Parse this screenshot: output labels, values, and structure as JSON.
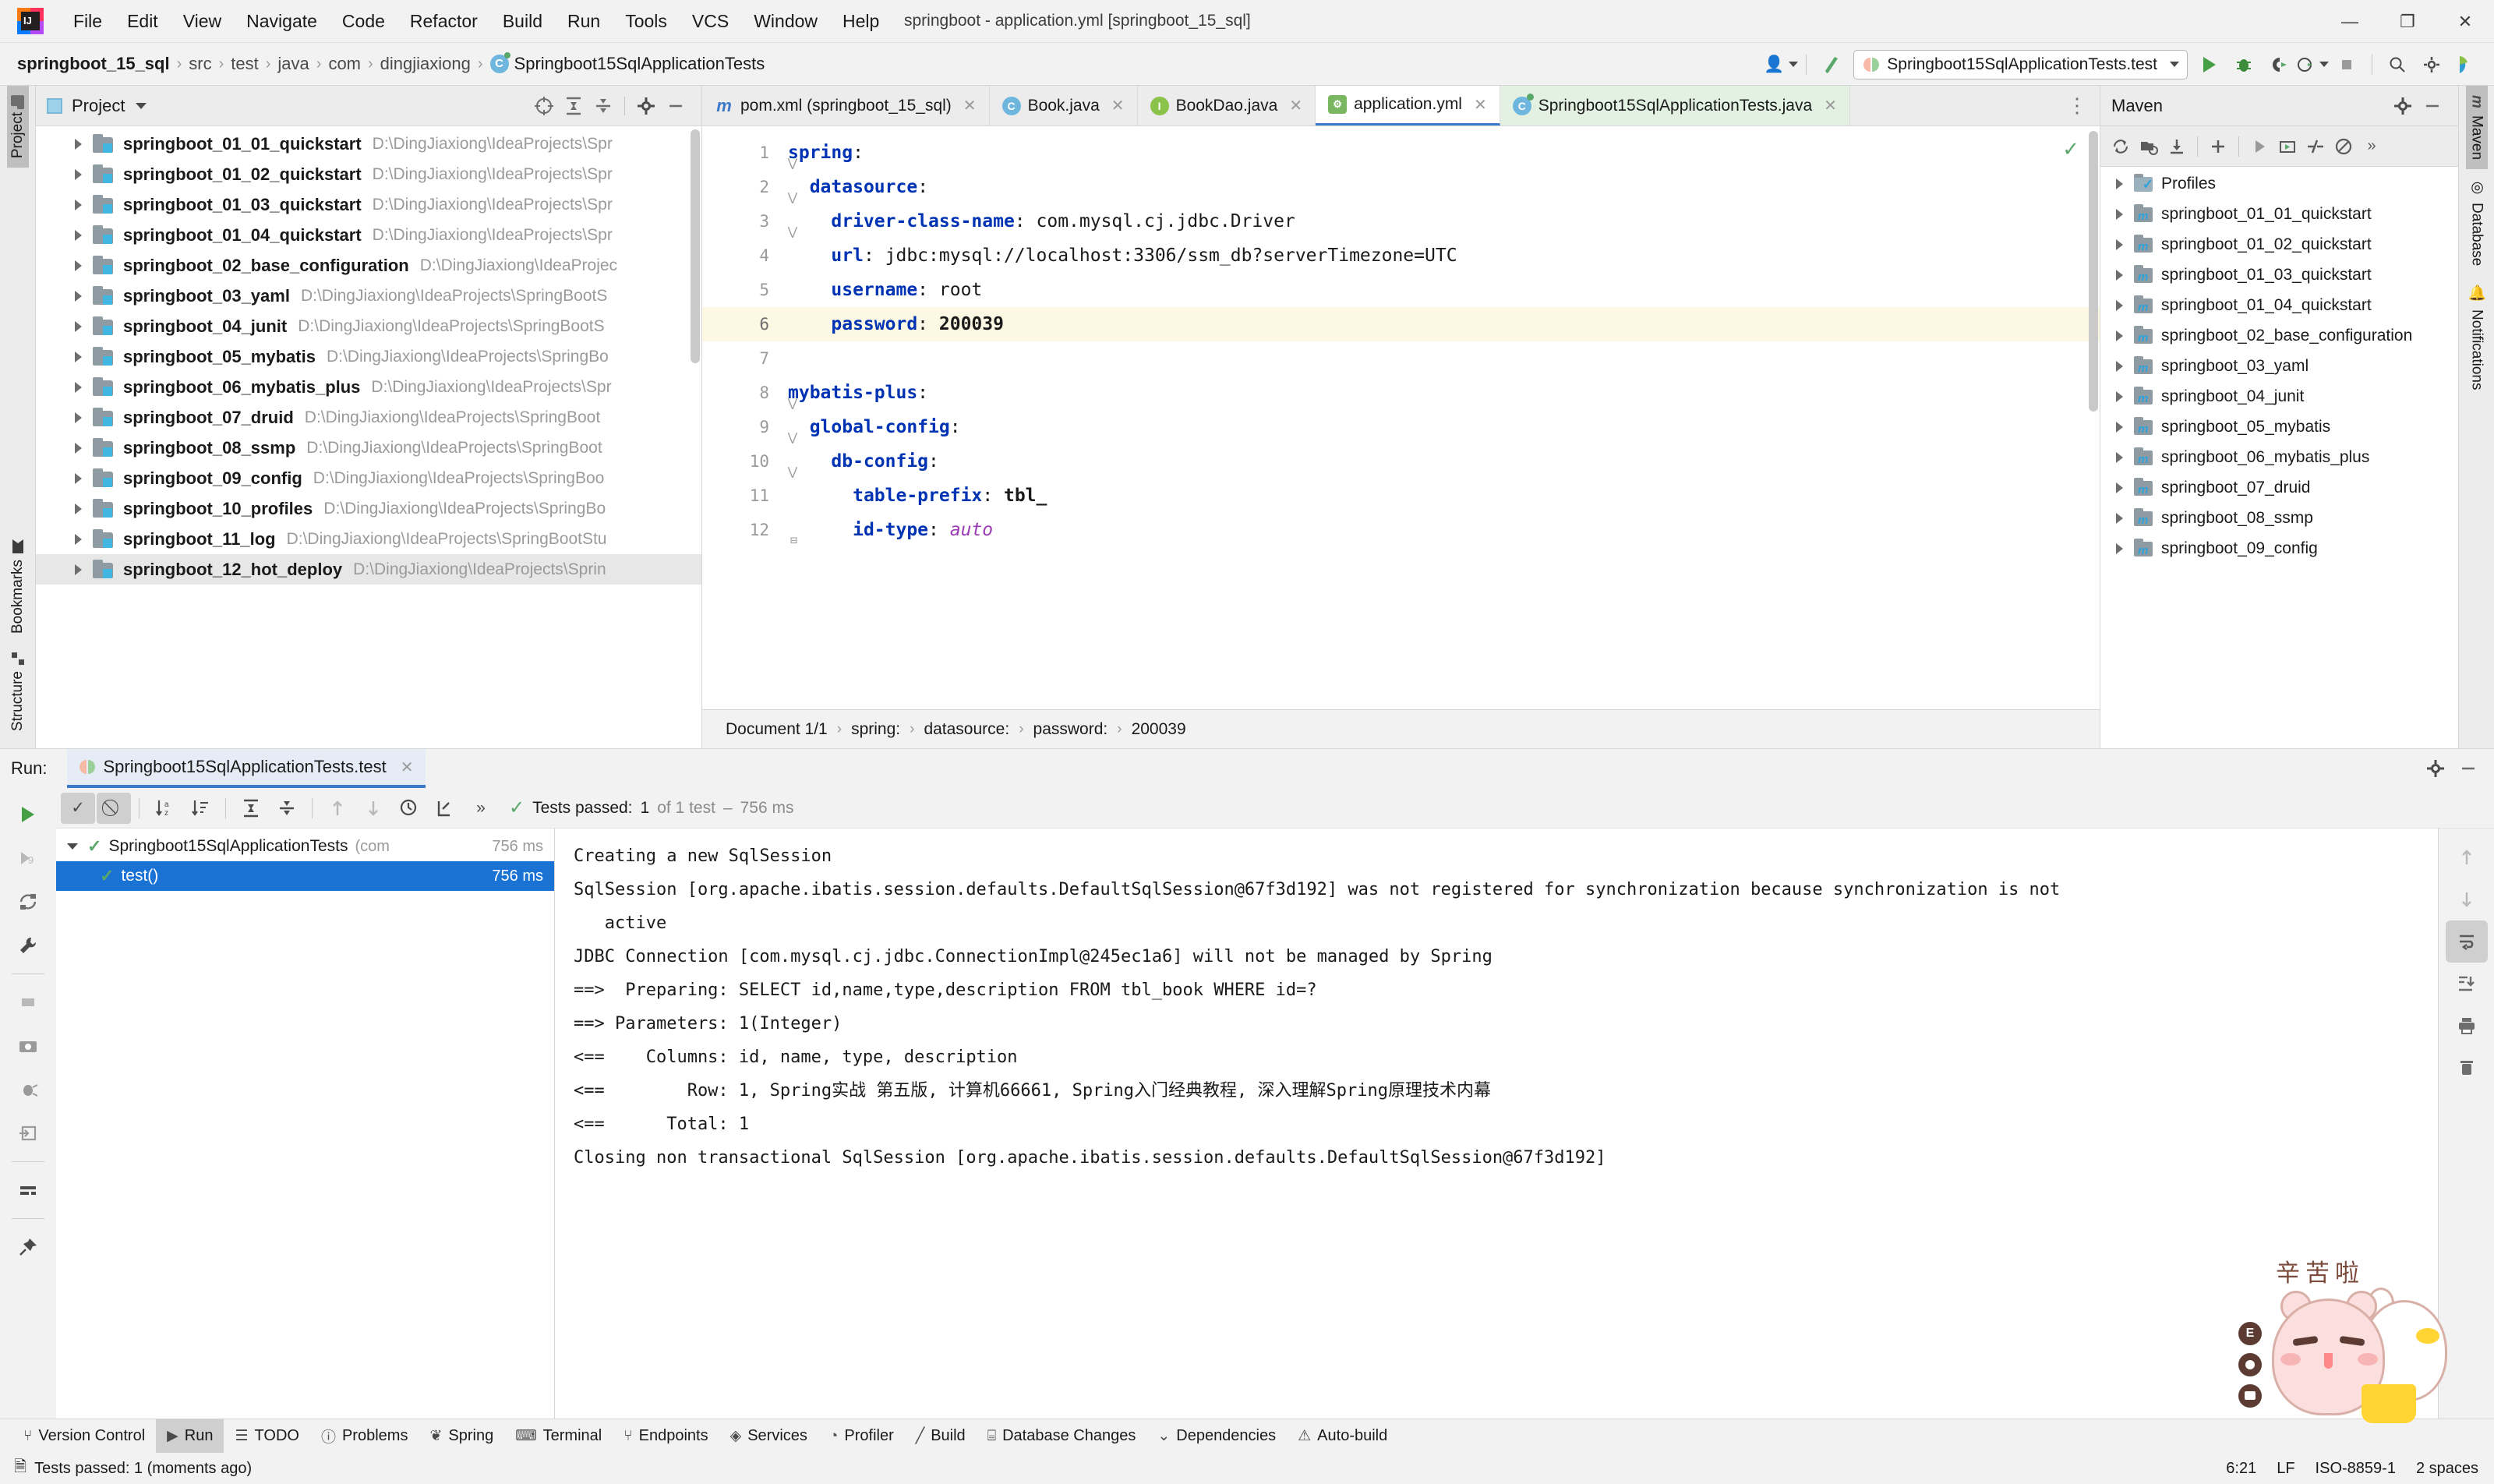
{
  "window": {
    "title": "springboot - application.yml [springboot_15_sql]",
    "minimize": "—",
    "maximize": "❐",
    "close": "✕",
    "logo_text": "IJ"
  },
  "menubar": {
    "items": [
      "File",
      "Edit",
      "View",
      "Navigate",
      "Code",
      "Refactor",
      "Build",
      "Run",
      "Tools",
      "VCS",
      "Window",
      "Help"
    ]
  },
  "navbar": {
    "crumbs": [
      "springboot_15_sql",
      "src",
      "test",
      "java",
      "com",
      "dingjiaxiong",
      "Springboot15SqlApplicationTests"
    ],
    "class_icon_letter": "C",
    "run_config": "Springboot15SqlApplicationTests.test",
    "icons": [
      "user-dropdown-icon",
      "build-hammer-icon",
      "run-icon",
      "debug-icon",
      "run-with-coverage-icon",
      "profile-icon",
      "stop-icon",
      "search-icon",
      "settings-icon",
      "ide-help-icon"
    ]
  },
  "left_strip": {
    "project_tab": "Project",
    "bookmarks_tab": "Bookmarks",
    "structure_tab": "Structure"
  },
  "project_panel": {
    "title": "Project",
    "toolbar_icons": [
      "select-opened-file-icon",
      "expand-all-icon",
      "collapse-all-icon",
      "gear-icon",
      "hide-icon"
    ],
    "items": [
      {
        "name": "springboot_01_01_quickstart",
        "path": "D:\\DingJiaxiong\\IdeaProjects\\Spr"
      },
      {
        "name": "springboot_01_02_quickstart",
        "path": "D:\\DingJiaxiong\\IdeaProjects\\Spr"
      },
      {
        "name": "springboot_01_03_quickstart",
        "path": "D:\\DingJiaxiong\\IdeaProjects\\Spr"
      },
      {
        "name": "springboot_01_04_quickstart",
        "path": "D:\\DingJiaxiong\\IdeaProjects\\Spr"
      },
      {
        "name": "springboot_02_base_configuration",
        "path": "D:\\DingJiaxiong\\IdeaProjec"
      },
      {
        "name": "springboot_03_yaml",
        "path": "D:\\DingJiaxiong\\IdeaProjects\\SpringBootS"
      },
      {
        "name": "springboot_04_junit",
        "path": "D:\\DingJiaxiong\\IdeaProjects\\SpringBootS"
      },
      {
        "name": "springboot_05_mybatis",
        "path": "D:\\DingJiaxiong\\IdeaProjects\\SpringBo"
      },
      {
        "name": "springboot_06_mybatis_plus",
        "path": "D:\\DingJiaxiong\\IdeaProjects\\Spr"
      },
      {
        "name": "springboot_07_druid",
        "path": "D:\\DingJiaxiong\\IdeaProjects\\SpringBoot"
      },
      {
        "name": "springboot_08_ssmp",
        "path": "D:\\DingJiaxiong\\IdeaProjects\\SpringBoot"
      },
      {
        "name": "springboot_09_config",
        "path": "D:\\DingJiaxiong\\IdeaProjects\\SpringBoo"
      },
      {
        "name": "springboot_10_profiles",
        "path": "D:\\DingJiaxiong\\IdeaProjects\\SpringBo"
      },
      {
        "name": "springboot_11_log",
        "path": "D:\\DingJiaxiong\\IdeaProjects\\SpringBootStu"
      },
      {
        "name": "springboot_12_hot_deploy",
        "path": "D:\\DingJiaxiong\\IdeaProjects\\Sprin"
      }
    ]
  },
  "editor": {
    "tabs": [
      {
        "label": "pom.xml (springboot_15_sql)",
        "icon": "maven-file-icon",
        "active": false,
        "green": false
      },
      {
        "label": "Book.java",
        "icon": "java-class-icon",
        "active": false,
        "green": false
      },
      {
        "label": "BookDao.java",
        "icon": "java-interface-icon",
        "active": false,
        "green": false
      },
      {
        "label": "application.yml",
        "icon": "spring-yaml-icon",
        "active": true,
        "green": false
      },
      {
        "label": "Springboot15SqlApplicationTests.java",
        "icon": "java-test-class-icon",
        "active": false,
        "green": true
      }
    ],
    "tab_close": "✕",
    "overflow": "⋮",
    "inspection_ok": "✓",
    "line_numbers": [
      "1",
      "2",
      "3",
      "4",
      "5",
      "6",
      "7",
      "8",
      "9",
      "10",
      "11",
      "12"
    ],
    "current_line": 6,
    "lines": [
      {
        "n": 1,
        "indent": 0,
        "key": "spring",
        "value": ""
      },
      {
        "n": 2,
        "indent": 1,
        "key": "datasource",
        "value": ""
      },
      {
        "n": 3,
        "indent": 2,
        "key": "driver-class-name",
        "value": "com.mysql.cj.jdbc.Driver"
      },
      {
        "n": 4,
        "indent": 2,
        "key": "url",
        "value": "jdbc:mysql://localhost:3306/ssm_db?serverTimezone=UTC"
      },
      {
        "n": 5,
        "indent": 2,
        "key": "username",
        "value": "root"
      },
      {
        "n": 6,
        "indent": 2,
        "key": "password",
        "value": "200039"
      },
      {
        "n": 7,
        "indent": 0,
        "key": "",
        "value": ""
      },
      {
        "n": 8,
        "indent": 0,
        "key": "mybatis-plus",
        "value": ""
      },
      {
        "n": 9,
        "indent": 1,
        "key": "global-config",
        "value": ""
      },
      {
        "n": 10,
        "indent": 2,
        "key": "db-config",
        "value": ""
      },
      {
        "n": 11,
        "indent": 3,
        "key": "table-prefix",
        "value": "tbl_"
      },
      {
        "n": 12,
        "indent": 3,
        "key": "id-type",
        "value": "auto"
      }
    ],
    "breadcrumb": [
      "Document 1/1",
      "spring:",
      "datasource:",
      "password:",
      "200039"
    ]
  },
  "maven_panel": {
    "title": "Maven",
    "toolbar_icons": [
      "reload-icon",
      "add-module-icon",
      "download-sources-icon",
      "add-icon",
      "run-icon",
      "execute-goal-icon",
      "skip-tests-icon",
      "toggle-offline-icon",
      "more-icon"
    ],
    "items": [
      "Profiles",
      "springboot_01_01_quickstart",
      "springboot_01_02_quickstart",
      "springboot_01_03_quickstart",
      "springboot_01_04_quickstart",
      "springboot_02_base_configuration",
      "springboot_03_yaml",
      "springboot_04_junit",
      "springboot_05_mybatis",
      "springboot_06_mybatis_plus",
      "springboot_07_druid",
      "springboot_08_ssmp",
      "springboot_09_config"
    ]
  },
  "right_strip": {
    "tabs": [
      "Maven",
      "Database",
      "Notifications"
    ]
  },
  "run_panel": {
    "label": "Run:",
    "tab_title": "Springboot15SqlApplicationTests.test",
    "tab_close": "✕",
    "sidebar_icons": [
      "rerun-icon",
      "rerun-failed-icon",
      "rerun-auto-icon",
      "settings-wrench-icon",
      "stop-icon",
      "screenshot-icon",
      "toggle-bug-icon",
      "import-tests-icon",
      "layout-icon",
      "pin-icon"
    ],
    "toolbar_icons": [
      "show-passed-icon",
      "show-ignored-icon",
      "sort-alphabetically-icon",
      "sort-by-duration-icon",
      "expand-all-icon",
      "collapse-all-icon",
      "prev-failed-icon",
      "next-failed-icon",
      "history-icon",
      "export-icon",
      "more-icon"
    ],
    "status": {
      "passed_label": "Tests passed:",
      "passed_count": "1",
      "of_text": "of 1 test",
      "dash": "–",
      "duration": "756 ms"
    },
    "tree": [
      {
        "name": "Springboot15SqlApplicationTests",
        "sub": "(com",
        "ms": "756 ms",
        "selected": false,
        "root": true
      },
      {
        "name": "test()",
        "sub": "",
        "ms": "756 ms",
        "selected": true,
        "root": false
      }
    ],
    "console_lines": [
      "Creating a new SqlSession",
      "SqlSession [org.apache.ibatis.session.defaults.DefaultSqlSession@67f3d192] was not registered for synchronization because synchronization is not",
      "   active",
      "JDBC Connection [com.mysql.cj.jdbc.ConnectionImpl@245ec1a6] will not be managed by Spring",
      "==>  Preparing: SELECT id,name,type,description FROM tbl_book WHERE id=?",
      "==> Parameters: 1(Integer)",
      "<==    Columns: id, name, type, description",
      "<==        Row: 1, Spring实战 第五版, 计算机66661, Spring入门经典教程, 深入理解Spring原理技术内幕",
      "<==      Total: 1",
      "Closing non transactional SqlSession [org.apache.ibatis.session.defaults.DefaultSqlSession@67f3d192]"
    ],
    "console_side_icons": [
      "scroll-up-icon",
      "scroll-down-icon",
      "soft-wrap-icon",
      "scroll-to-end-icon",
      "print-icon",
      "clear-all-icon"
    ]
  },
  "toolwindow_bar": {
    "items": [
      {
        "label": "Version Control",
        "icon": "branch-icon",
        "active": false
      },
      {
        "label": "Run",
        "icon": "run-icon",
        "active": true
      },
      {
        "label": "TODO",
        "icon": "todo-icon",
        "active": false
      },
      {
        "label": "Problems",
        "icon": "problems-icon",
        "active": false
      },
      {
        "label": "Spring",
        "icon": "spring-leaf-icon",
        "active": false
      },
      {
        "label": "Terminal",
        "icon": "terminal-icon",
        "active": false
      },
      {
        "label": "Endpoints",
        "icon": "endpoints-icon",
        "active": false
      },
      {
        "label": "Services",
        "icon": "services-icon",
        "active": false
      },
      {
        "label": "Profiler",
        "icon": "profiler-icon",
        "active": false
      },
      {
        "label": "Build",
        "icon": "build-icon",
        "active": false
      },
      {
        "label": "Database Changes",
        "icon": "database-changes-icon",
        "active": false
      },
      {
        "label": "Dependencies",
        "icon": "dependencies-icon",
        "active": false
      },
      {
        "label": "Auto-build",
        "icon": "auto-build-icon",
        "active": false
      }
    ]
  },
  "statusbar": {
    "message": "Tests passed: 1 (moments ago)",
    "caret": "6:21",
    "line_sep": "LF",
    "encoding": "ISO-8859-1",
    "indent": "2 spaces"
  },
  "mascot": {
    "text": "辛苦啦",
    "badge_letter": "E"
  },
  "colors": {
    "accent_blue": "#3c79c8",
    "selection_blue": "#1a73d4",
    "success_green": "#59a869",
    "yaml_key": "#0033b3",
    "yaml_auto": "#9b3ab5",
    "current_line": "#fdf8e3"
  }
}
